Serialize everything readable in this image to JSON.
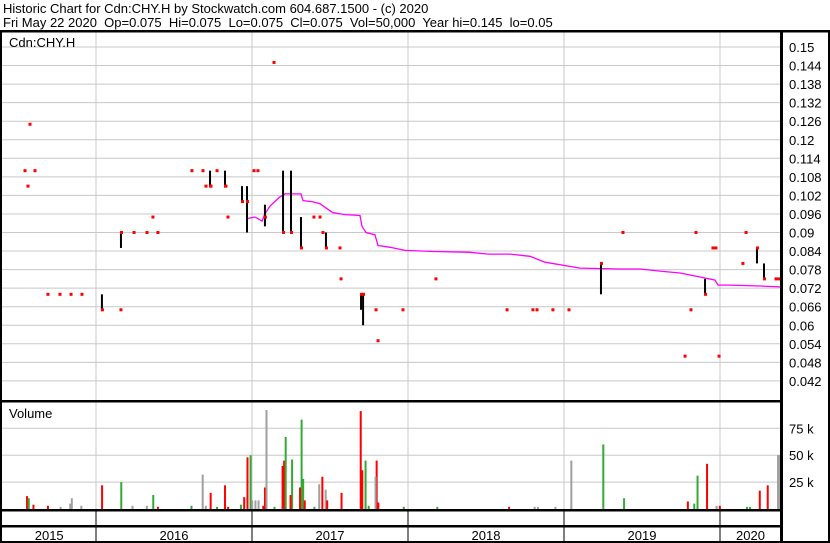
{
  "header": {
    "title": "Historic Chart for Cdn:CHY.H by Stockwatch.com 604.687.1500 - (c) 2020",
    "quote": "Fri May 22 2020  Op=0.075  Hi=0.075  Lo=0.075  Cl=0.075  Vol=50,000  Year hi=0.145  lo=0.05"
  },
  "colors": {
    "up": "#33aa33",
    "down": "#ff0000",
    "flat": "#a0a0a0",
    "ma": "#ff00ff",
    "grid": "#c8c8c8",
    "bar": "#000000"
  },
  "chart_data": [
    {
      "type": "line",
      "title": "Cdn:CHY.H",
      "ylabel": "",
      "ylim": [
        0.039,
        0.155
      ],
      "xlim": [
        2015.4,
        2020.4
      ],
      "yticks": [
        "0.15",
        "0.144",
        "0.138",
        "0.132",
        "0.126",
        "0.12",
        "0.114",
        "0.108",
        "0.102",
        "0.096",
        "0.09",
        "0.084",
        "0.078",
        "0.072",
        "0.066",
        "0.06",
        "0.054",
        "0.048",
        "0.042"
      ],
      "grid": true,
      "price_dots": [
        [
          2015.545,
          0.11
        ],
        [
          2015.609,
          0.11
        ],
        [
          2015.564,
          0.105
        ],
        [
          2015.577,
          0.125
        ],
        [
          2015.692,
          0.07
        ],
        [
          2015.769,
          0.07
        ],
        [
          2015.84,
          0.07
        ],
        [
          2015.91,
          0.07
        ],
        [
          2016.16,
          0.065
        ],
        [
          2016.244,
          0.09
        ],
        [
          2016.327,
          0.09
        ],
        [
          2016.365,
          0.095
        ],
        [
          2016.397,
          0.09
        ],
        [
          2016.615,
          0.11
        ],
        [
          2016.686,
          0.11
        ],
        [
          2016.705,
          0.105
        ],
        [
          2016.776,
          0.11
        ],
        [
          2016.737,
          0.105
        ],
        [
          2016.833,
          0.105
        ],
        [
          2016.846,
          0.095
        ],
        [
          2017.013,
          0.11
        ],
        [
          2017.038,
          0.11
        ],
        [
          2017.141,
          0.145
        ],
        [
          2017.397,
          0.095
        ],
        [
          2017.436,
          0.095
        ],
        [
          2017.455,
          0.09
        ],
        [
          2017.564,
          0.085
        ],
        [
          2017.571,
          0.075
        ],
        [
          2017.795,
          0.065
        ],
        [
          2017.808,
          0.055
        ],
        [
          2017.968,
          0.065
        ],
        [
          2018.179,
          0.075
        ],
        [
          2018.635,
          0.065
        ],
        [
          2018.801,
          0.065
        ],
        [
          2018.827,
          0.065
        ],
        [
          2018.929,
          0.065
        ],
        [
          2019.032,
          0.065
        ],
        [
          2019.378,
          0.09
        ],
        [
          2019.776,
          0.05
        ],
        [
          2019.814,
          0.065
        ],
        [
          2019.846,
          0.09
        ],
        [
          2019.955,
          0.085
        ],
        [
          2019.974,
          0.085
        ],
        [
          2019.994,
          0.05
        ],
        [
          2020.147,
          0.08
        ],
        [
          2020.167,
          0.09
        ],
        [
          2020.359,
          0.075
        ],
        [
          2020.378,
          0.075
        ]
      ],
      "ohlc_bars": [
        [
          2016.038,
          0.07,
          0.065,
          0.065
        ],
        [
          2016.16,
          0.09,
          0.085,
          0.09
        ],
        [
          2016.731,
          0.11,
          0.105,
          0.105
        ],
        [
          2016.827,
          0.11,
          0.105,
          0.105
        ],
        [
          2016.936,
          0.105,
          0.1,
          0.1
        ],
        [
          2016.968,
          0.105,
          0.09,
          0.1
        ],
        [
          2017.083,
          0.099,
          0.092,
          0.095
        ],
        [
          2017.199,
          0.11,
          0.09,
          0.09
        ],
        [
          2017.25,
          0.11,
          0.09,
          0.09
        ],
        [
          2017.314,
          0.095,
          0.085,
          0.085
        ],
        [
          2017.474,
          0.09,
          0.085,
          0.085
        ],
        [
          2017.699,
          0.07,
          0.065,
          0.07
        ],
        [
          2017.712,
          0.07,
          0.06,
          0.07
        ],
        [
          2019.237,
          0.08,
          0.07,
          0.08
        ],
        [
          2019.904,
          0.075,
          0.07,
          0.07
        ],
        [
          2020.237,
          0.085,
          0.08,
          0.085
        ],
        [
          2020.282,
          0.08,
          0.075,
          0.075
        ]
      ],
      "moving_average": [
        [
          2016.968,
          0.0945
        ],
        [
          2017.019,
          0.095
        ],
        [
          2017.064,
          0.0937
        ],
        [
          2017.083,
          0.096
        ],
        [
          2017.115,
          0.0985
        ],
        [
          2017.179,
          0.1015
        ],
        [
          2017.211,
          0.1025
        ],
        [
          2017.314,
          0.1025
        ],
        [
          2017.327,
          0.1003
        ],
        [
          2017.385,
          0.1
        ],
        [
          2017.436,
          0.0993
        ],
        [
          2017.481,
          0.0977
        ],
        [
          2017.519,
          0.0964
        ],
        [
          2017.596,
          0.0958
        ],
        [
          2017.692,
          0.0955
        ],
        [
          2017.705,
          0.092
        ],
        [
          2017.731,
          0.09
        ],
        [
          2017.788,
          0.0893
        ],
        [
          2017.808,
          0.0858
        ],
        [
          2017.885,
          0.0852
        ],
        [
          2017.981,
          0.0842
        ],
        [
          2018.141,
          0.0839
        ],
        [
          2018.397,
          0.0836
        ],
        [
          2018.513,
          0.083
        ],
        [
          2018.654,
          0.083
        ],
        [
          2018.782,
          0.0823
        ],
        [
          2018.878,
          0.0804
        ],
        [
          2019.103,
          0.0785
        ],
        [
          2019.359,
          0.0782
        ],
        [
          2019.487,
          0.0782
        ],
        [
          2019.615,
          0.0775
        ],
        [
          2019.744,
          0.0769
        ],
        [
          2019.872,
          0.0756
        ],
        [
          2019.968,
          0.0746
        ],
        [
          2019.987,
          0.073
        ],
        [
          2020.064,
          0.073
        ],
        [
          2020.256,
          0.0727
        ],
        [
          2020.385,
          0.0724
        ]
      ]
    },
    {
      "type": "bar",
      "title": "Volume",
      "ylim": [
        0,
        100000
      ],
      "yticks": [
        "75 k",
        "50 k",
        "25 k"
      ],
      "ytick_values": [
        75000,
        50000,
        25000
      ],
      "bars": [
        [
          2015.558,
          12000,
          "down"
        ],
        [
          2015.569,
          10000,
          "up"
        ],
        [
          2015.599,
          4000,
          "down"
        ],
        [
          2015.692,
          3000,
          "down"
        ],
        [
          2015.773,
          2000,
          "flat"
        ],
        [
          2015.835,
          5000,
          "flat"
        ],
        [
          2015.845,
          10000,
          "flat"
        ],
        [
          2015.906,
          3000,
          "flat"
        ],
        [
          2016.039,
          22000,
          "down"
        ],
        [
          2016.162,
          25000,
          "up"
        ],
        [
          2016.234,
          3000,
          "flat"
        ],
        [
          2016.326,
          3000,
          "flat"
        ],
        [
          2016.367,
          13000,
          "up"
        ],
        [
          2016.397,
          2000,
          "down"
        ],
        [
          2016.612,
          3000,
          "up"
        ],
        [
          2016.684,
          32000,
          "flat"
        ],
        [
          2016.704,
          3000,
          "flat"
        ],
        [
          2016.735,
          15000,
          "down"
        ],
        [
          2016.776,
          2000,
          "up"
        ],
        [
          2016.827,
          22000,
          "down"
        ],
        [
          2016.847,
          2000,
          "down"
        ],
        [
          2016.929,
          4000,
          "up"
        ],
        [
          2016.95,
          11000,
          "down"
        ],
        [
          2016.971,
          48000,
          "down"
        ],
        [
          2016.991,
          50000,
          "up"
        ],
        [
          2017.001,
          8000,
          "flat"
        ],
        [
          2017.022,
          8000,
          "flat"
        ],
        [
          2017.042,
          8000,
          "flat"
        ],
        [
          2017.072,
          3000,
          "down"
        ],
        [
          2017.083,
          20000,
          "down"
        ],
        [
          2017.093,
          92000,
          "flat"
        ],
        [
          2017.144,
          2000,
          "up"
        ],
        [
          2017.196,
          40000,
          "down"
        ],
        [
          2017.206,
          45000,
          "down"
        ],
        [
          2017.216,
          67000,
          "up"
        ],
        [
          2017.257,
          46000,
          "up"
        ],
        [
          2017.247,
          13000,
          "down"
        ],
        [
          2017.318,
          83000,
          "up"
        ],
        [
          2017.308,
          20000,
          "down"
        ],
        [
          2017.328,
          28000,
          "up"
        ],
        [
          2017.338,
          8000,
          "down"
        ],
        [
          2017.4,
          2000,
          "up"
        ],
        [
          2017.431,
          23000,
          "flat"
        ],
        [
          2017.451,
          30000,
          "down"
        ],
        [
          2017.472,
          18000,
          "flat"
        ],
        [
          2017.482,
          8000,
          "down"
        ],
        [
          2017.574,
          15000,
          "down"
        ],
        [
          2017.697,
          91000,
          "down"
        ],
        [
          2017.707,
          36000,
          "down"
        ],
        [
          2017.728,
          45000,
          "up"
        ],
        [
          2017.748,
          3000,
          "up"
        ],
        [
          2017.799,
          45000,
          "down"
        ],
        [
          2017.792,
          30000,
          "flat"
        ],
        [
          2017.81,
          6000,
          "down"
        ],
        [
          2017.973,
          2000,
          "up"
        ],
        [
          2018.188,
          2000,
          "up"
        ],
        [
          2018.648,
          2000,
          "down"
        ],
        [
          2018.812,
          2000,
          "flat"
        ],
        [
          2018.833,
          2000,
          "flat"
        ],
        [
          2018.945,
          2000,
          "flat"
        ],
        [
          2019.047,
          45000,
          "flat"
        ],
        [
          2019.252,
          60000,
          "up"
        ],
        [
          2019.385,
          10000,
          "up"
        ],
        [
          2019.794,
          7000,
          "down"
        ],
        [
          2019.835,
          5000,
          "up"
        ],
        [
          2019.856,
          31000,
          "up"
        ],
        [
          2019.917,
          42000,
          "down"
        ],
        [
          2019.978,
          3000,
          "flat"
        ],
        [
          2019.999,
          3000,
          "down"
        ],
        [
          2020.173,
          2000,
          "up"
        ],
        [
          2020.193,
          2000,
          "up"
        ],
        [
          2020.255,
          17000,
          "down"
        ],
        [
          2020.306,
          22000,
          "down"
        ],
        [
          2020.372,
          50000,
          "flat"
        ],
        [
          2020.385,
          50000,
          "flat"
        ]
      ]
    }
  ],
  "x_axis": {
    "years": [
      "2015",
      "2016",
      "2017",
      "2018",
      "2019",
      "2020"
    ]
  }
}
